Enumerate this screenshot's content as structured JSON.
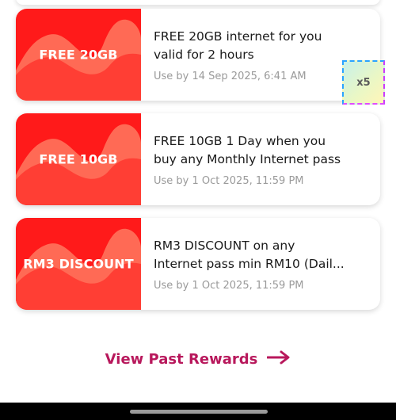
{
  "rewards": [
    {
      "badge_text": "FREE 20GB",
      "title_line1": "FREE 20GB internet for you",
      "title_line2": "valid for 2 hours",
      "expiry": "Use by 14 Sep 2025, 6:41 AM",
      "count": "x5"
    },
    {
      "badge_text": "FREE 10GB",
      "title_line1": "FREE 10GB 1 Day when you",
      "title_line2": "buy any Monthly Internet pass",
      "expiry": "Use by 1 Oct 2025, 11:59 PM"
    },
    {
      "badge_text": "RM3 DISCOUNT",
      "title_line1": "RM3 DISCOUNT on any",
      "title_line2": "Internet pass min RM10 (Dail...",
      "expiry": "Use by 1 Oct 2025, 11:59 PM"
    }
  ],
  "past_rewards": {
    "label": "View Past Rewards",
    "icon": "arrow-right-icon"
  },
  "colors": {
    "badge_red": "#ff1a1a",
    "badge_wave": "#ff6a55",
    "link_magenta": "#b8185c",
    "title_text": "#1a1a1a",
    "expiry_text": "#9a9a9a"
  }
}
